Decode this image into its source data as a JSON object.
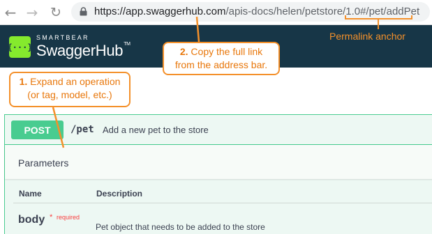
{
  "browser": {
    "url_host": "https://app.swaggerhub.com",
    "url_path": "/apis-docs/helen/petstore/1.0#/pet/addPet",
    "icons": [
      "back-arrow-icon",
      "forward-arrow-icon",
      "reload-icon",
      "lock-icon"
    ]
  },
  "header": {
    "brand_small": "SMARTBEAR",
    "brand_big": "SwaggerHub",
    "brand_tm": "TM",
    "logo_glyph": "{···}",
    "colors": {
      "background": "#173647",
      "logo": "#85ea2d"
    }
  },
  "callouts": {
    "step2": {
      "number": "2.",
      "line1": "Copy the full link",
      "line2": "from the address bar."
    },
    "step1": {
      "number": "1.",
      "line1": "Expand an operation",
      "line2": "(or tag, model, etc.)"
    },
    "permalink_label": "Permalink anchor",
    "color": "#f4902a"
  },
  "operation": {
    "method": "POST",
    "path": "/pet",
    "summary": "Add a new pet to the store",
    "parameters_title": "Parameters",
    "columns": {
      "name": "Name",
      "description": "Description"
    },
    "params": [
      {
        "name": "body",
        "required_star": "*",
        "required_label": "required",
        "description": "Pet object that needs to be added to the store"
      }
    ],
    "colors": {
      "post": "#49cc90",
      "required": "#f93e3e"
    }
  }
}
